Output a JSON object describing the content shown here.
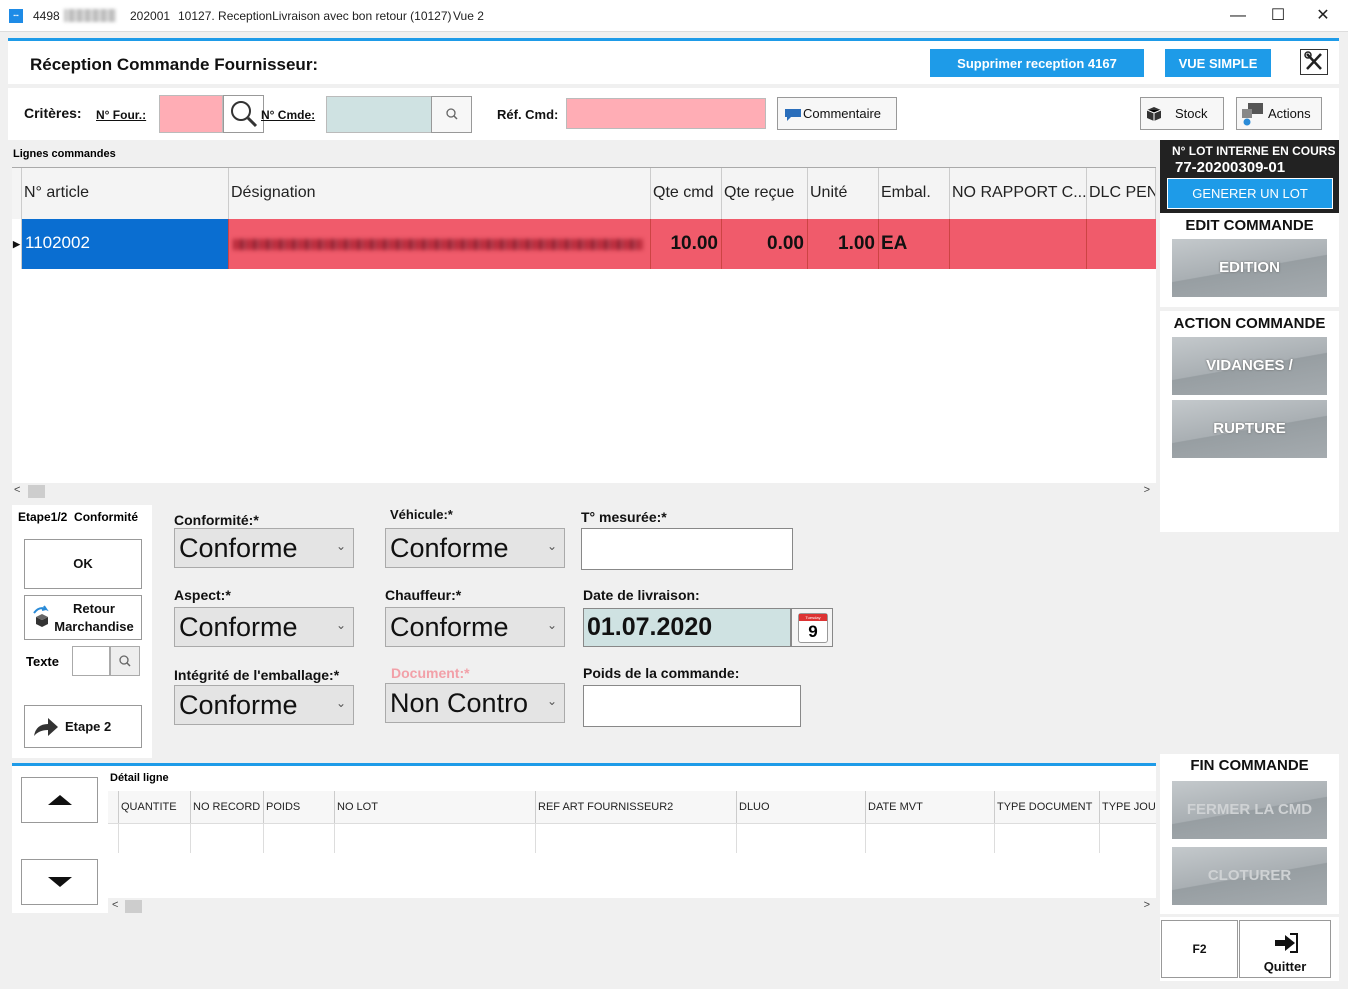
{
  "titlebar": {
    "app_icon": "app-icon",
    "user_id": "4498",
    "code": "202001",
    "title": "10127. ReceptionLivraison avec bon retour (10127)",
    "view": "Vue 2",
    "minimize": "—",
    "maximize": "☐",
    "close": "✕"
  },
  "header": {
    "title": "Réception Commande Fournisseur:",
    "delete_btn": "Supprimer reception 4167",
    "simple_view_btn": "VUE SIMPLE",
    "tools_icon": "tools-icon"
  },
  "criteria": {
    "label": "Critères:",
    "supplier_label": "N° Four.:",
    "order_label": "N° Cmde:",
    "ref_label": "Réf. Cmd:",
    "comment_btn": "Commentaire",
    "stock_btn": "Stock",
    "actions_btn": "Actions"
  },
  "grid": {
    "section_label": "Lignes commandes",
    "columns": [
      "N° article",
      "Désignation",
      "Qte cmd",
      "Qte reçue",
      "Unité",
      "Embal.",
      "NO RAPPORT C...",
      "DLC PENA"
    ],
    "rows": [
      {
        "article": "1102002",
        "designation": "",
        "qte_cmd": "10.00",
        "qte_recue": "0.00",
        "unite": "1.00",
        "embal": "EA",
        "rapport": "",
        "dlc": ""
      }
    ],
    "row_indicator": "▶",
    "scroll_left": "<",
    "scroll_right": ">"
  },
  "right_panel": {
    "lot_title": "N° LOT INTERNE EN COURS",
    "lot_number": "77-20200309-01",
    "generate_btn": "GENERER UN LOT",
    "edit_title": "EDIT COMMANDE",
    "edition_btn": "EDITION",
    "action_title": "ACTION COMMANDE",
    "vidanges_btn": "VIDANGES / PALETTE",
    "rupture_btn": "RUPTURE",
    "fin_title": "FIN COMMANDE",
    "fermer_btn": "FERMER LA CMD",
    "cloturer_btn": "CLOTURER",
    "f2_btn": "F2",
    "quit_btn": "Quitter"
  },
  "step": {
    "title": "Etape1/2  Conformité",
    "ok_btn": "OK",
    "retour_btn_line1": "Retour",
    "retour_btn_line2": "Marchandise",
    "texte_label": "Texte",
    "etape2_btn": "Etape 2",
    "conformite_label": "Conformité:*",
    "conformite_value": "Conforme",
    "vehicule_label": "Véhicule:*",
    "vehicule_value": "Conforme",
    "temp_label": "T° mesurée:*",
    "temp_value": "",
    "aspect_label": "Aspect:*",
    "aspect_value": "Conforme",
    "chauffeur_label": "Chauffeur:*",
    "chauffeur_value": "Conforme",
    "date_label": "Date de livraison:",
    "date_value": "01.07.2020",
    "calendar_day": "9",
    "calendar_header": "Tuesday",
    "integrite_label": "Intégrité de l'emballage:*",
    "integrite_value": "Conforme",
    "document_label": "Document:*",
    "document_value": "Non Contro",
    "poids_label": "Poids de la commande:",
    "poids_value": ""
  },
  "detail": {
    "section_label": "Détail ligne",
    "columns": [
      "QUANTITE",
      "NO RECORD",
      "POIDS",
      "NO LOT",
      "REF ART FOURNISSEUR2",
      "DLUO",
      "DATE MVT",
      "TYPE DOCUMENT",
      "TYPE JOUR"
    ],
    "scroll_left": "<",
    "scroll_right": ">"
  },
  "colors": {
    "accent": "#1e9be8",
    "row_highlight": "#f05b6b",
    "selected_cell": "#0a6ed1",
    "required_pink": "#ffadb5"
  }
}
